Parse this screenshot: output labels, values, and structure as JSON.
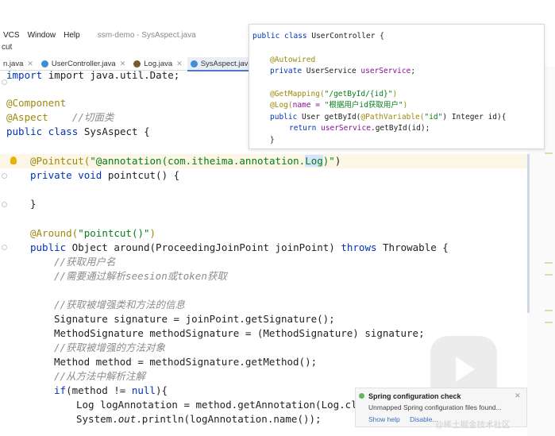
{
  "menubar": {
    "items": [
      "VCS",
      "Window",
      "Help"
    ],
    "window_title": "ssm-demo - SysAspect.java"
  },
  "breadcrumb": "cut",
  "tabs": [
    {
      "label": "n.java",
      "color": "#3d8fd6",
      "active": false
    },
    {
      "label": "UserController.java",
      "color": "#3d8fd6",
      "active": false
    },
    {
      "label": "Log.java",
      "color": "#7a5b2a",
      "active": false
    },
    {
      "label": "SysAspect.java",
      "color": "#3d8fd6",
      "active": true
    }
  ],
  "code": {
    "l0": "import java.util.Date;",
    "l1": "@Component",
    "l2a": "@Aspect",
    "l2b": "//切面类",
    "l3a": "public class",
    "l3b": " SysAspect {",
    "l4a": "@Pointcut(",
    "l4b": "\"@annotation(com.itheima.annotation.",
    "l4c": "Log",
    "l4d": ")\"",
    "l4e": ")",
    "l5a": "private void",
    "l5b": " pointcut() {",
    "l6": "}",
    "l7a": "@Around(",
    "l7b": "\"pointcut()\"",
    "l7c": ")",
    "l8a": "public",
    "l8b": " Object around(ProceedingJoinPoint joinPoint) ",
    "l8c": "throws",
    "l8d": " Throwable {",
    "l9": "//获取用户名",
    "l10": "//需要通过解析seesion或token获取",
    "l11": "//获取被增强类和方法的信息",
    "l12": "Signature signature = joinPoint.getSignature();",
    "l13": "MethodSignature methodSignature = (MethodSignature) signature;",
    "l14": "//获取被增强的方法对象",
    "l15": "Method method = methodSignature.getMethod();",
    "l16": "//从方法中解析注解",
    "l17a": "if",
    "l17b": "(method != ",
    "l17c": "null",
    "l17d": "){",
    "l18a": "Log logAnnotation = method.getAnnotation(",
    "l18b": "Log",
    "l18c": ".cla",
    "l19a": "System.",
    "l19b": "out",
    "l19c": ".println(logAnnotation.name());"
  },
  "popup": {
    "p0a": "public class",
    "p0b": " UserController {",
    "p1": "@Autowired",
    "p2a": "private",
    "p2b": " UserService ",
    "p2c": "userService",
    "p2d": ";",
    "p3a": "@GetMapping(",
    "p3b": "\"/getById/{id}\"",
    "p3c": ")",
    "p4a": "@Log(",
    "p4b": "name = ",
    "p4c": "\"根据用户id获取用户\"",
    "p4d": ")",
    "p5a": "public",
    "p5b": " User getById(",
    "p5c": "@PathVariable(",
    "p5d": "\"id\"",
    "p5e": ") Integer id){",
    "p6a": "return",
    "p6b": " userService",
    "p6c": ".getById(id);",
    "p7": "}"
  },
  "notification": {
    "title": "Spring configuration check",
    "body": "Unmapped Spring configuration files found...",
    "show_help": "Show help",
    "disable": "Disable..."
  },
  "watermark": "@稀土掘金技术社区"
}
